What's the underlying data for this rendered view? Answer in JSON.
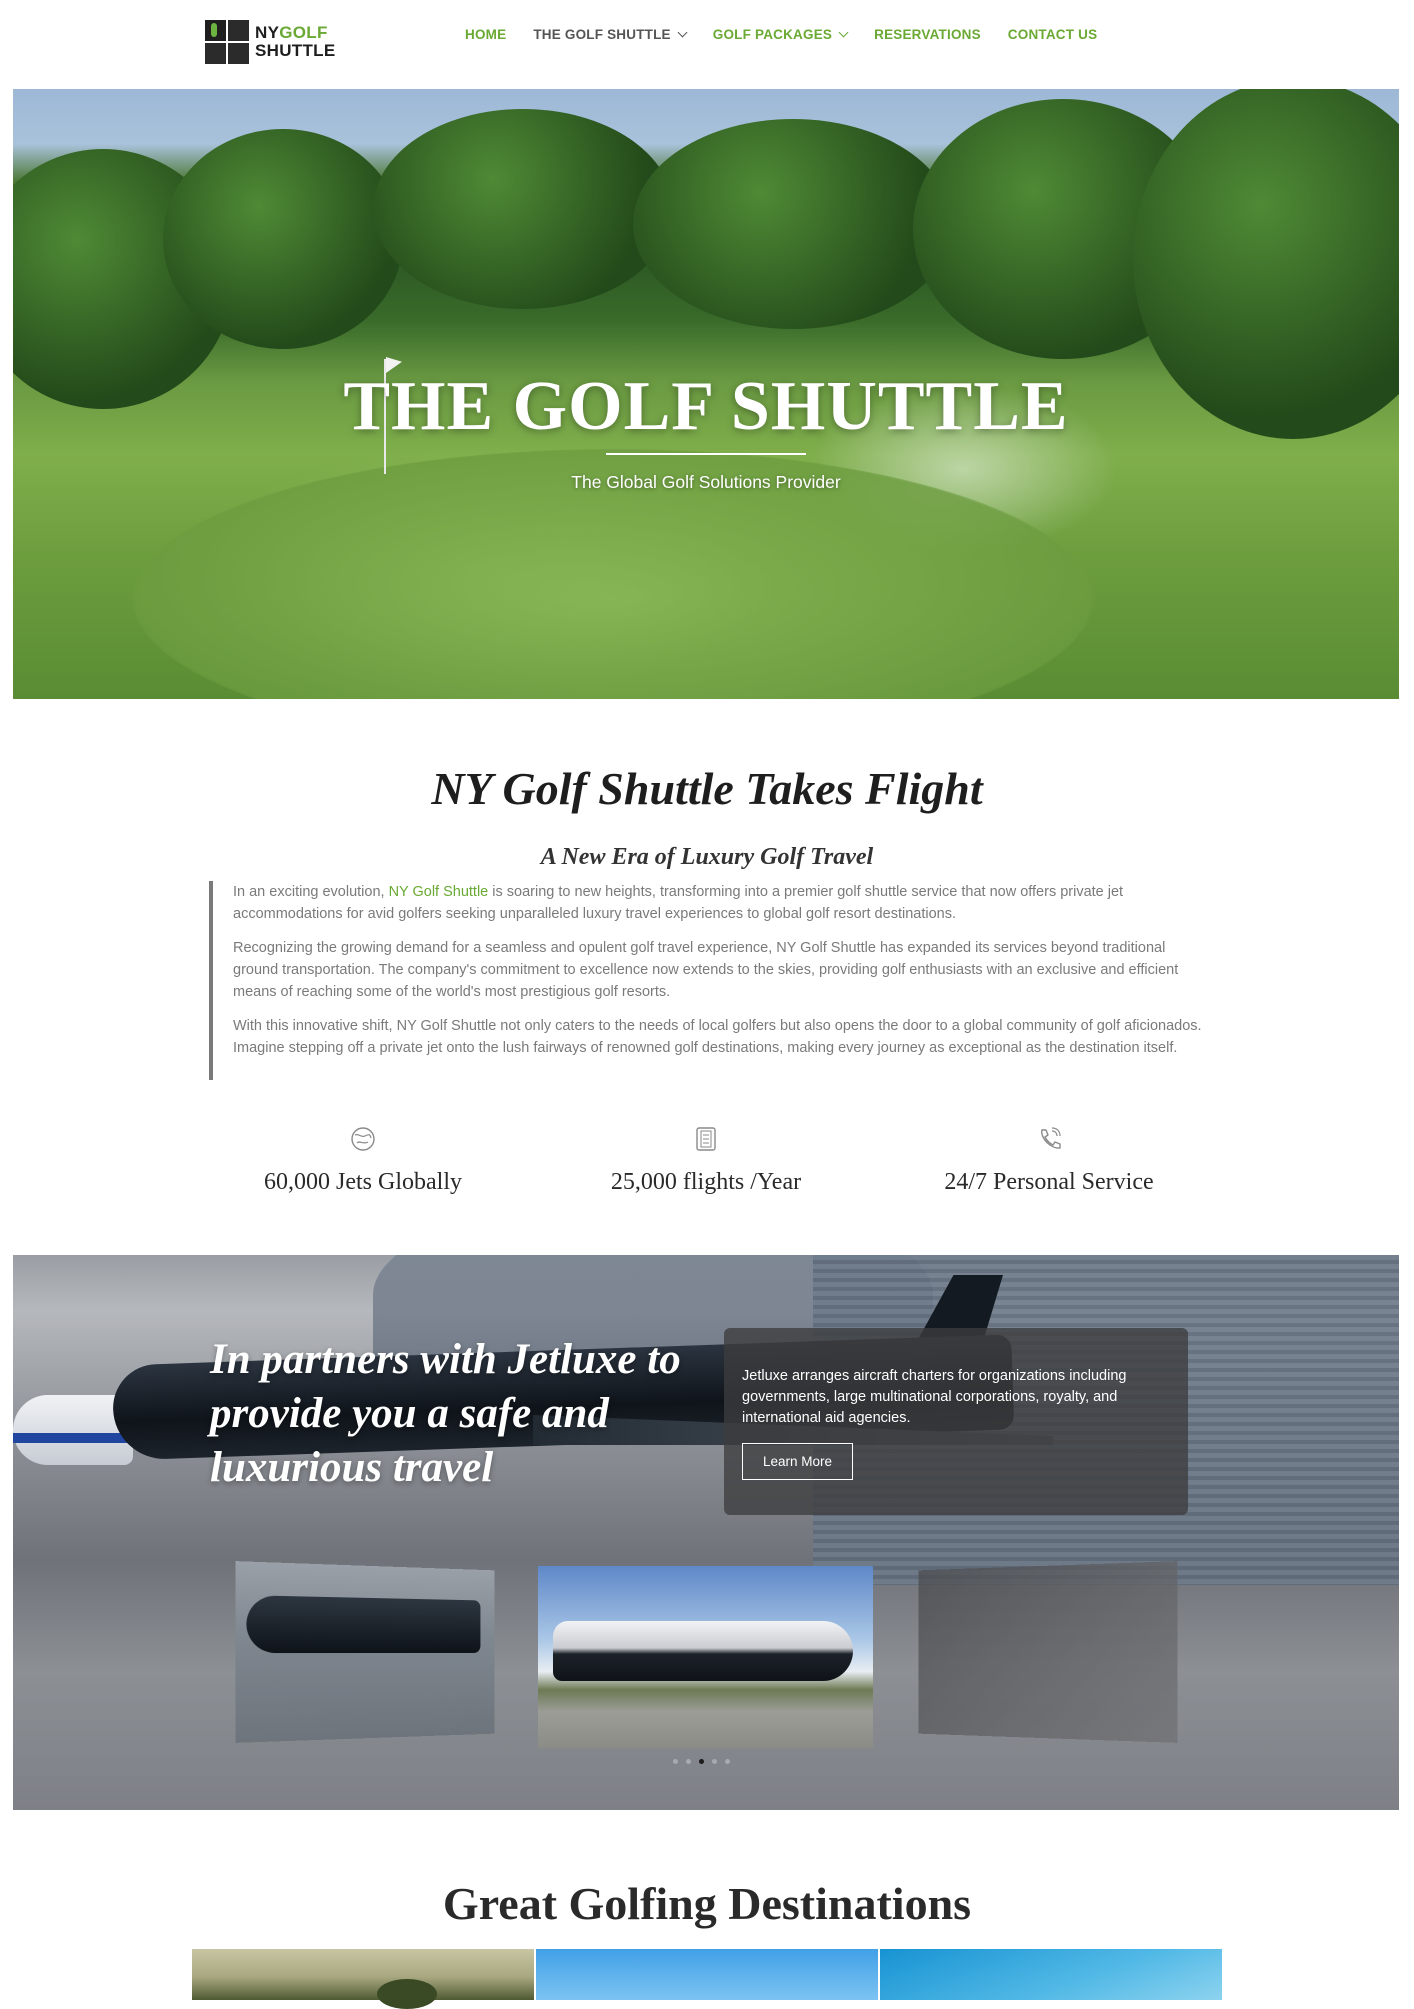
{
  "header": {
    "logo": {
      "line1_a": "NY",
      "line1_b": "GOLF",
      "line2": "SHUTTLE"
    },
    "nav": [
      {
        "label": "HOME",
        "has_dropdown": false
      },
      {
        "label": "THE GOLF SHUTTLE",
        "has_dropdown": true
      },
      {
        "label": "GOLF PACKAGES",
        "has_dropdown": true
      },
      {
        "label": "RESERVATIONS",
        "has_dropdown": false
      },
      {
        "label": "CONTACT US",
        "has_dropdown": false
      }
    ]
  },
  "hero": {
    "title": "THE GOLF SHUTTLE",
    "subtitle": "The Global Golf Solutions Provider"
  },
  "intro": {
    "title": "NY Golf Shuttle Takes Flight",
    "subtitle": "A New Era of Luxury Golf Travel",
    "p1_before": "In an exciting evolution, ",
    "p1_link": "NY Golf Shuttle",
    "p1_after": " is soaring to new heights, transforming into a premier golf shuttle service that now offers private jet accommodations for avid golfers seeking unparalleled luxury travel experiences to global golf resort destinations.",
    "p2": "Recognizing the growing demand for a seamless and opulent golf travel experience, NY Golf Shuttle has expanded its services beyond traditional ground transportation. The company's commitment to excellence now extends to the skies, providing golf enthusiasts with an exclusive and efficient means of reaching some of the world's most prestigious golf resorts.",
    "p3": "With this innovative shift, NY Golf Shuttle not only caters to the needs of local golfers but also opens the door to a global community of golf aficionados. Imagine stepping off a private jet onto the lush fairways of renowned golf destinations, making every journey as exceptional as the destination itself."
  },
  "stats": [
    {
      "label": "60,000 Jets Globally",
      "icon": "globe-icon"
    },
    {
      "label": "25,000 flights /Year",
      "icon": "document-icon"
    },
    {
      "label": "24/7 Personal Service",
      "icon": "phone-icon"
    }
  ],
  "partner": {
    "title": "In partners with Jetluxe to provide you a safe and luxurious travel",
    "description": "Jetluxe arranges aircraft charters for organizations including governments, large multinational corporations, royalty, and international aid agencies.",
    "button": "Learn More",
    "carousel_active_index": 2,
    "carousel_count": 5
  },
  "destinations": {
    "title": "Great Golfing Destinations"
  },
  "colors": {
    "accent_green": "#6aa933",
    "nav_dark": "#555555",
    "body_text": "#7a7a7a",
    "heading": "#1e1e1e"
  }
}
